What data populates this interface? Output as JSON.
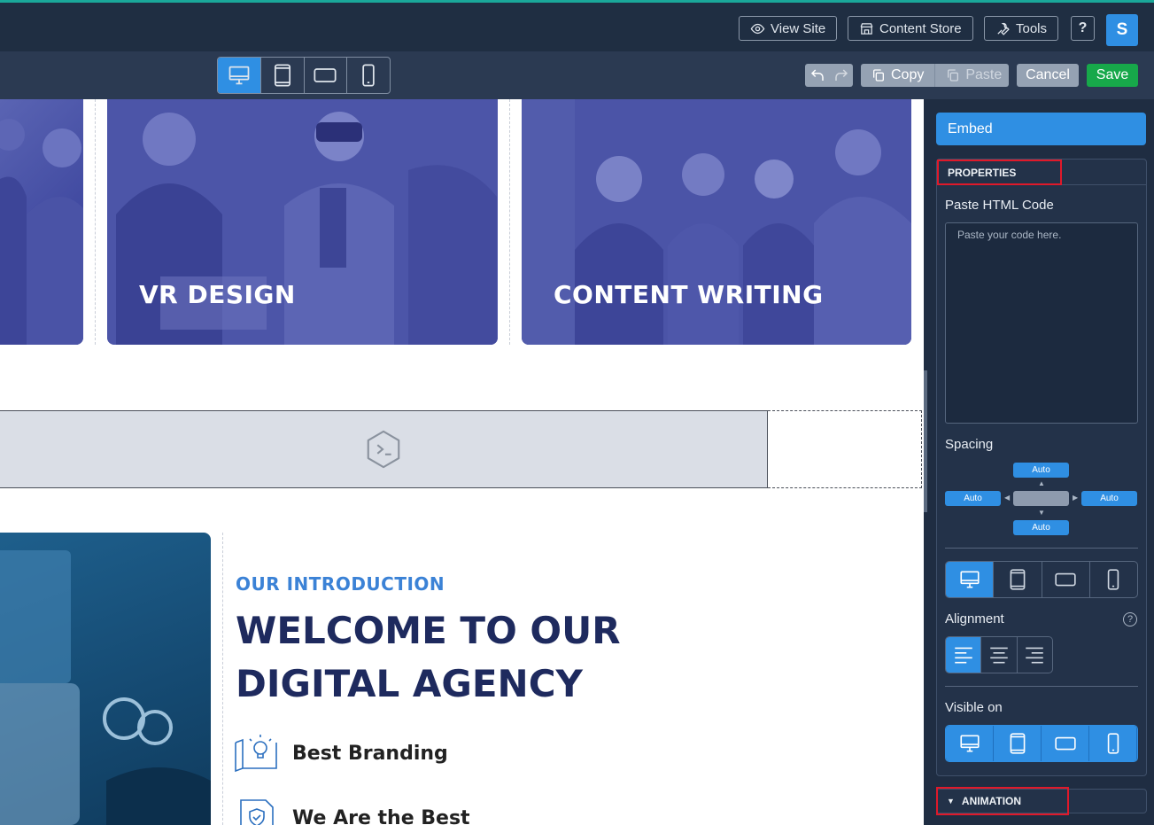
{
  "topbar": {
    "view_site": "View Site",
    "content_store": "Content Store",
    "tools": "Tools",
    "help": "?",
    "avatar_initial": "S",
    "accent_color": "#1aa89a"
  },
  "toolbar": {
    "devices": [
      "desktop",
      "tablet",
      "tablet-landscape",
      "mobile"
    ],
    "active_device": "desktop",
    "copy_label": "Copy",
    "paste_label": "Paste",
    "cancel_label": "Cancel",
    "save_label": "Save"
  },
  "canvas": {
    "cards": [
      {
        "title": ""
      },
      {
        "title": "VR DESIGN"
      },
      {
        "title": "CONTENT WRITING"
      }
    ],
    "intro": {
      "kicker": "OUR INTRODUCTION",
      "title": "WELCOME TO OUR DIGITAL AGENCY",
      "features": [
        {
          "label": "Best Branding",
          "icon": "lightbulb-blueprint-icon"
        },
        {
          "label": "We Are the Best",
          "icon": "shield-document-icon"
        }
      ]
    }
  },
  "panel": {
    "header": "Embed",
    "properties_tab": "PROPERTIES",
    "paste_html_label": "Paste HTML Code",
    "code_placeholder": "Paste your code here.",
    "spacing_label": "Spacing",
    "spacing": {
      "top": "Auto",
      "left": "Auto",
      "right": "Auto",
      "bottom": "Auto"
    },
    "alignment_label": "Alignment",
    "alignment_help": "?",
    "visible_on_label": "Visible on",
    "animation_tab": "ANIMATION"
  }
}
